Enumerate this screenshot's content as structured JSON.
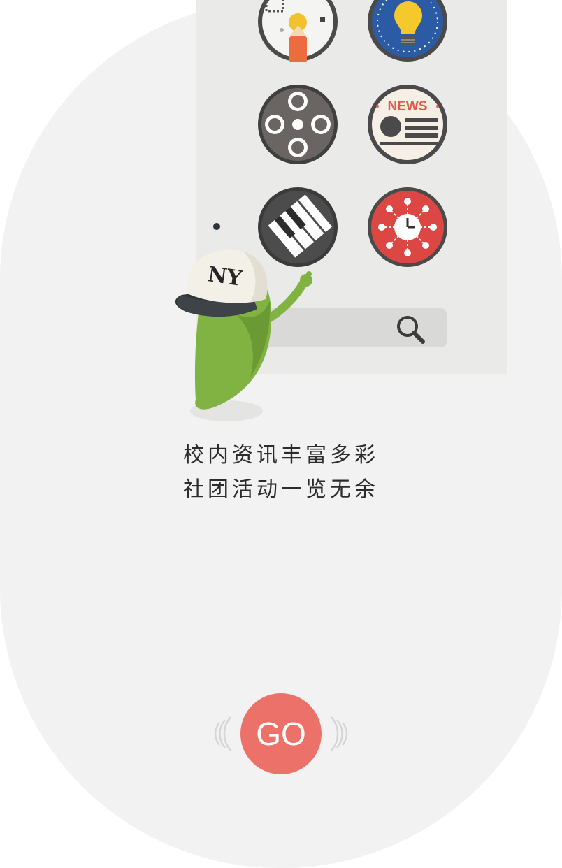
{
  "colors": {
    "background": "#f2f2f3",
    "panel": "#eaeae9",
    "accent": "#ec7269",
    "mascot_green": "#80b341",
    "text": "#2c2c2c"
  },
  "apps": [
    {
      "name": "design-tools-app",
      "icon": "pencil-canvas-icon"
    },
    {
      "name": "ideas-app",
      "icon": "lightbulb-compass-icon"
    },
    {
      "name": "movie-reel-app",
      "icon": "film-reel-icon"
    },
    {
      "name": "news-app",
      "icon": "newspaper-icon",
      "label": "NEWS"
    },
    {
      "name": "piano-app",
      "icon": "piano-keys-icon"
    },
    {
      "name": "clock-network-app",
      "icon": "clock-network-icon"
    }
  ],
  "search": {
    "icon": "search-icon"
  },
  "mascot": {
    "cap_logo": "NY"
  },
  "slogan": {
    "line1": "校内资讯丰富多彩",
    "line2": "社团活动一览无余"
  },
  "go_button": {
    "label": "GO"
  }
}
